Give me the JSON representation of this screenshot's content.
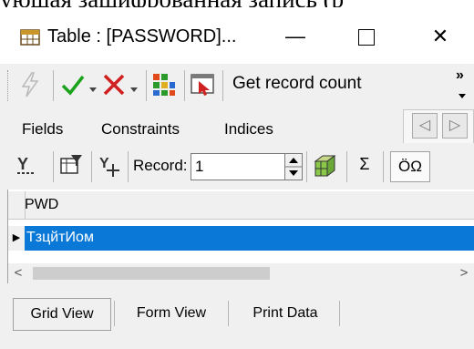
{
  "background_text": "ующая зашифрованная запись (р",
  "window": {
    "title": "Table : [PASSWORD]...",
    "minimize_glyph": "—",
    "maximize_glyph": "☐",
    "close_glyph": "✕"
  },
  "toolbar": {
    "get_record_count_label": "Get record count",
    "overflow_glyph": "»",
    "icons": [
      "lightning-icon",
      "check-icon",
      "dropdown-icon",
      "cross-icon",
      "dropdown-icon",
      "grid-icon",
      "form-icon"
    ]
  },
  "tabs": {
    "fields": "Fields",
    "constraints": "Constraints",
    "indices": "Indices",
    "prev_glyph": "◁",
    "next_glyph": "▷"
  },
  "grid_toolbar": {
    "record_label": "Record:",
    "record_value": "1",
    "sigma_glyph": "Σ",
    "charset_label": "ÖΩ"
  },
  "grid": {
    "column_header": "PWD",
    "row_indicator": "▶",
    "rows": [
      "ТзцйтИом"
    ],
    "scroll_left_glyph": "<",
    "scroll_right_glyph": ">"
  },
  "bottom_tabs": {
    "grid_view": "Grid View",
    "form_view": "Form View",
    "print_data": "Print Data"
  },
  "colors": {
    "selection": "#0a78d7",
    "check_green": "#1aa31a",
    "cross_red": "#d02020"
  }
}
